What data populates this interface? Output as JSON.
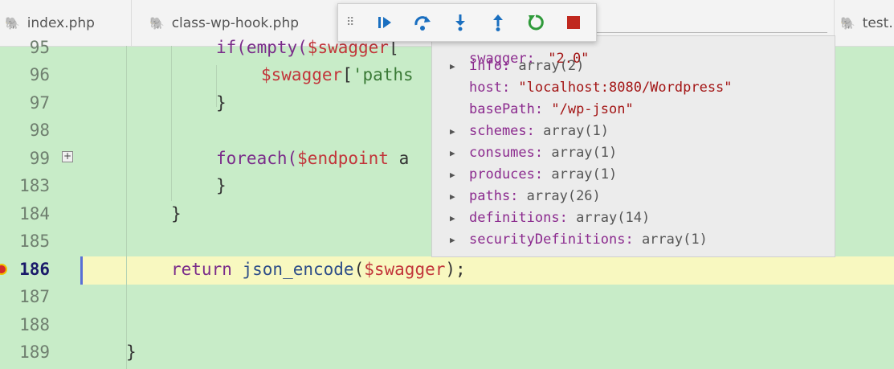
{
  "tabs": [
    {
      "label": "index.php"
    },
    {
      "label": "class-wp-hook.php"
    },
    {
      "label": "test.p"
    }
  ],
  "toolbar": {
    "continue": "continue-icon",
    "step_over": "step-over-icon",
    "step_into": "step-into-icon",
    "step_out": "step-out-icon",
    "restart": "restart-icon",
    "stop": "stop-icon"
  },
  "gutter": {
    "lines": [
      "95",
      "96",
      "97",
      "98",
      "99",
      "183",
      "184",
      "185",
      "186",
      "187",
      "188",
      "189"
    ],
    "current_line": "186"
  },
  "code": {
    "l95_a": "if(empty(",
    "l95_b": "$swagger",
    "l95_c": "[",
    "l96_a": "$swagger",
    "l96_b": "[",
    "l96_c": "'paths",
    "l97": "}",
    "l99_a": "foreach(",
    "l99_b": "$endpoint",
    "l99_c": " a",
    "l183": "}",
    "l184": "}",
    "l186_a": "return",
    "l186_b": " json_encode",
    "l186_c": "(",
    "l186_d": "$swagger",
    "l186_e": ");",
    "l189": "}"
  },
  "hover": {
    "cut_key": "swagger:",
    "cut_val": " \"2.0\"",
    "rows": [
      {
        "key": "info:",
        "value": " array(2)",
        "expandable": true,
        "type": "array"
      },
      {
        "key": "host:",
        "value": " \"localhost:8080/Wordpress\"",
        "expandable": false,
        "type": "string"
      },
      {
        "key": "basePath:",
        "value": " \"/wp-json\"",
        "expandable": false,
        "type": "string"
      },
      {
        "key": "schemes:",
        "value": " array(1)",
        "expandable": true,
        "type": "array"
      },
      {
        "key": "consumes:",
        "value": " array(1)",
        "expandable": true,
        "type": "array"
      },
      {
        "key": "produces:",
        "value": " array(1)",
        "expandable": true,
        "type": "array"
      },
      {
        "key": "paths:",
        "value": " array(26)",
        "expandable": true,
        "type": "array"
      },
      {
        "key": "definitions:",
        "value": " array(14)",
        "expandable": true,
        "type": "array"
      },
      {
        "key": "securityDefinitions:",
        "value": " array(1)",
        "expandable": true,
        "type": "array"
      }
    ]
  }
}
